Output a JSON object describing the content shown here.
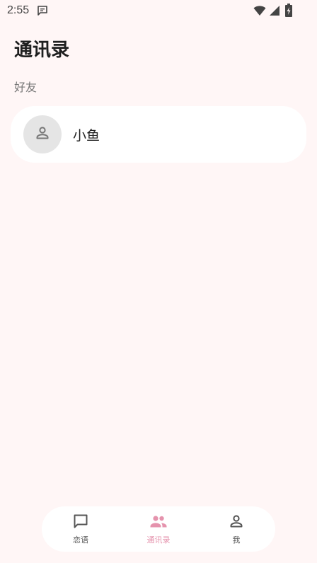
{
  "status_bar": {
    "time": "2:55"
  },
  "header": {
    "title": "通讯录"
  },
  "section": {
    "label": "好友"
  },
  "contacts": [
    {
      "name": "小鱼"
    }
  ],
  "bottom_nav": {
    "items": [
      {
        "label": "恋语",
        "icon": "chat-bubble-icon",
        "active": false
      },
      {
        "label": "通讯录",
        "icon": "people-icon",
        "active": true
      },
      {
        "label": "我",
        "icon": "person-icon",
        "active": false
      }
    ]
  },
  "colors": {
    "background": "#fff6f6",
    "card": "#ffffff",
    "accent": "#e593ad",
    "avatar_bg": "#e5e5e5"
  }
}
